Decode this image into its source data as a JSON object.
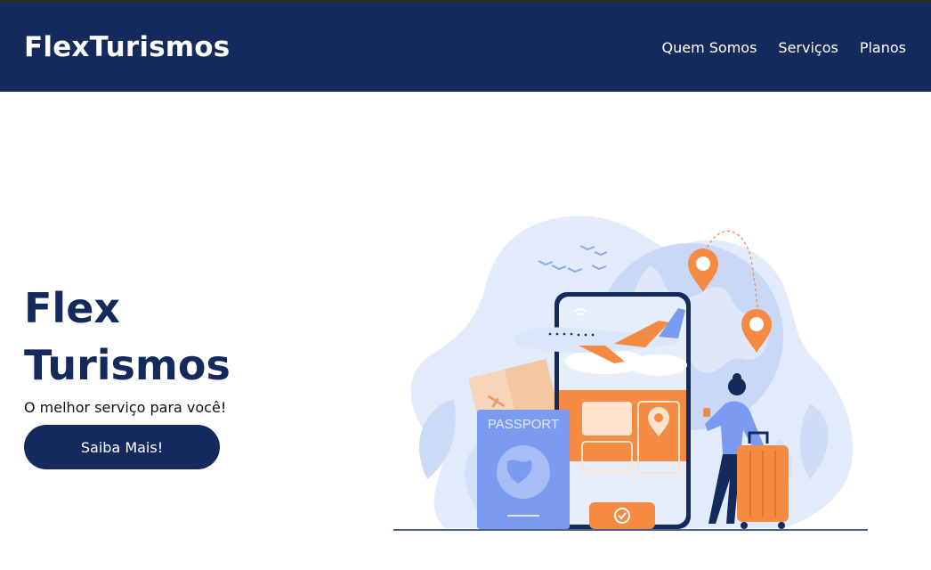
{
  "header": {
    "logo": "FlexTurismos",
    "nav": [
      "Quem Somos",
      "Serviços",
      "Planos"
    ]
  },
  "hero": {
    "title_line1": "Flex",
    "title_line2": "Turismos",
    "subtitle": "O melhor serviço para você!",
    "cta_label": "Saiba Mais!"
  },
  "illustration": {
    "passport_label": "PASSPORT"
  },
  "colors": {
    "brand": "#142a5c",
    "accent": "#f58a42",
    "light_blue": "#dfe9fb",
    "mid_blue": "#7b9bf0"
  }
}
